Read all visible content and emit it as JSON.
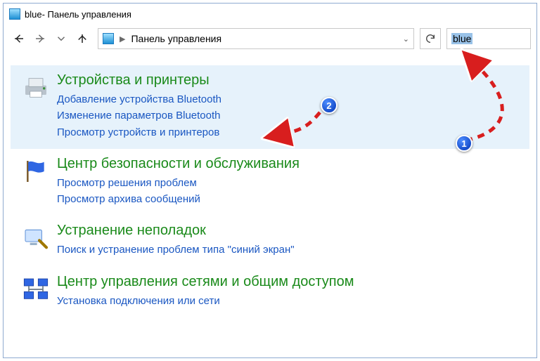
{
  "title_prefix": "blue",
  "title_suffix": " - Панель управления",
  "breadcrumb": "Панель управления",
  "search_query": "blue",
  "badges": {
    "one": "1",
    "two": "2"
  },
  "results": [
    {
      "heading": "Устройства и принтеры",
      "links": [
        "Добавление устройства Bluetooth",
        "Изменение параметров Bluetooth",
        "Просмотр устройств и принтеров"
      ]
    },
    {
      "heading": "Центр безопасности и обслуживания",
      "links": [
        "Просмотр решения проблем",
        "Просмотр архива сообщений"
      ]
    },
    {
      "heading": "Устранение неполадок",
      "links": [
        "Поиск и устранение проблем типа \"синий экран\""
      ]
    },
    {
      "heading": "Центр управления сетями и общим доступом",
      "links": [
        "Установка подключения или сети"
      ]
    }
  ]
}
